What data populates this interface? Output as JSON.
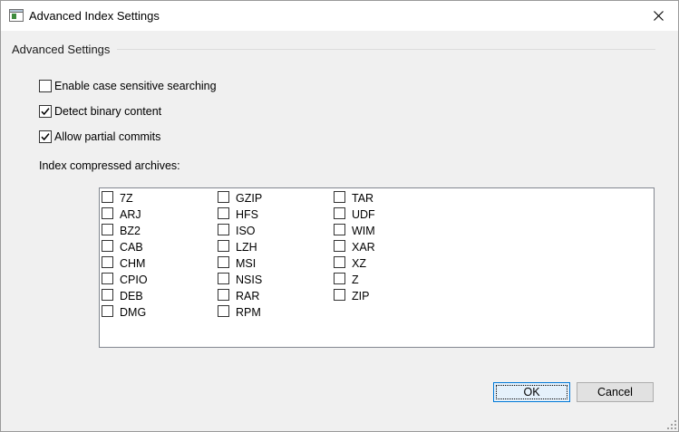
{
  "window": {
    "title": "Advanced Index Settings"
  },
  "group": {
    "label": "Advanced Settings"
  },
  "options": [
    {
      "label": "Enable case sensitive searching",
      "checked": false
    },
    {
      "label": "Detect binary content",
      "checked": true
    },
    {
      "label": "Allow partial commits",
      "checked": true
    }
  ],
  "archives": {
    "label": "Index compressed archives:",
    "columns": [
      [
        "7Z",
        "ARJ",
        "BZ2",
        "CAB",
        "CHM",
        "CPIO",
        "DEB",
        "DMG"
      ],
      [
        "GZIP",
        "HFS",
        "ISO",
        "LZH",
        "MSI",
        "NSIS",
        "RAR",
        "RPM"
      ],
      [
        "TAR",
        "UDF",
        "WIM",
        "XAR",
        "XZ",
        "Z",
        "ZIP"
      ]
    ]
  },
  "buttons": {
    "ok": "OK",
    "cancel": "Cancel"
  }
}
